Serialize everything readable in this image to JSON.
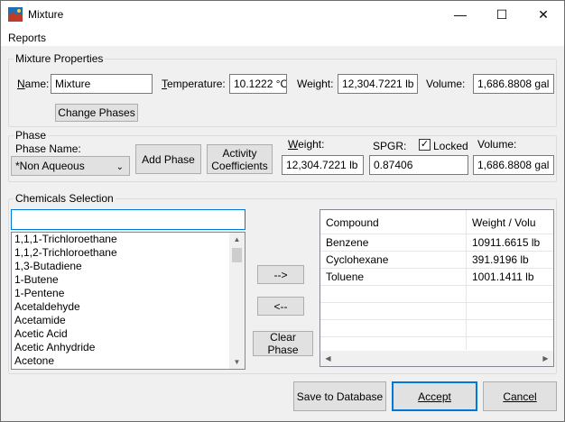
{
  "window": {
    "title": "Mixture",
    "minimize": "—",
    "maximize": "☐",
    "close": "✕"
  },
  "menu": {
    "reports": "Reports"
  },
  "mixture_properties": {
    "group_label": "Mixture Properties",
    "name_label": "Name:",
    "name_value": "Mixture",
    "temperature_label": "Temperature:",
    "temperature_value": "10.1222 °C",
    "weight_label": "Weight:",
    "weight_value": "12,304.7221 lb",
    "volume_label": "Volume:",
    "volume_value": "1,686.8808 gal",
    "change_phases": "Change Phases"
  },
  "phase": {
    "group_label": "Phase",
    "phase_name_label": "Phase Name:",
    "phase_name_value": "*Non Aqueous",
    "add_phase": "Add Phase",
    "activity_line1": "Activity",
    "activity_line2": "Coefficients",
    "weight_label": "Weight:",
    "weight_value": "12,304.7221 lb",
    "spgr_label": "SPGR:",
    "spgr_value": "0.87406",
    "locked_label": "Locked",
    "locked_checked": "✓",
    "volume_label": "Volume:",
    "volume_value": "1,686.8808 gal"
  },
  "chemicals": {
    "group_label": "Chemicals Selection",
    "search_value": "",
    "items": [
      "1,1,1-Trichloroethane",
      "1,1,2-Trichloroethane",
      "1,3-Butadiene",
      "1-Butene",
      "1-Pentene",
      "Acetaldehyde",
      "Acetamide",
      "Acetic Acid",
      "Acetic Anhydride",
      "Acetone"
    ],
    "add_arrow": "-->",
    "remove_arrow": "<--",
    "clear_phase": "Clear Phase",
    "table": {
      "headers": [
        "Compound",
        "Weight / Volu"
      ],
      "rows": [
        [
          "Benzene",
          "10911.6615 lb"
        ],
        [
          "Cyclohexane",
          "391.9196 lb"
        ],
        [
          "Toluene",
          "1001.1411 lb"
        ]
      ]
    }
  },
  "footer": {
    "save_to_database": "Save to Database",
    "accept": "Accept",
    "cancel": "Cancel"
  },
  "colors": {
    "focus_border": "#0078d7",
    "window_bg": "#f0f0f0"
  }
}
